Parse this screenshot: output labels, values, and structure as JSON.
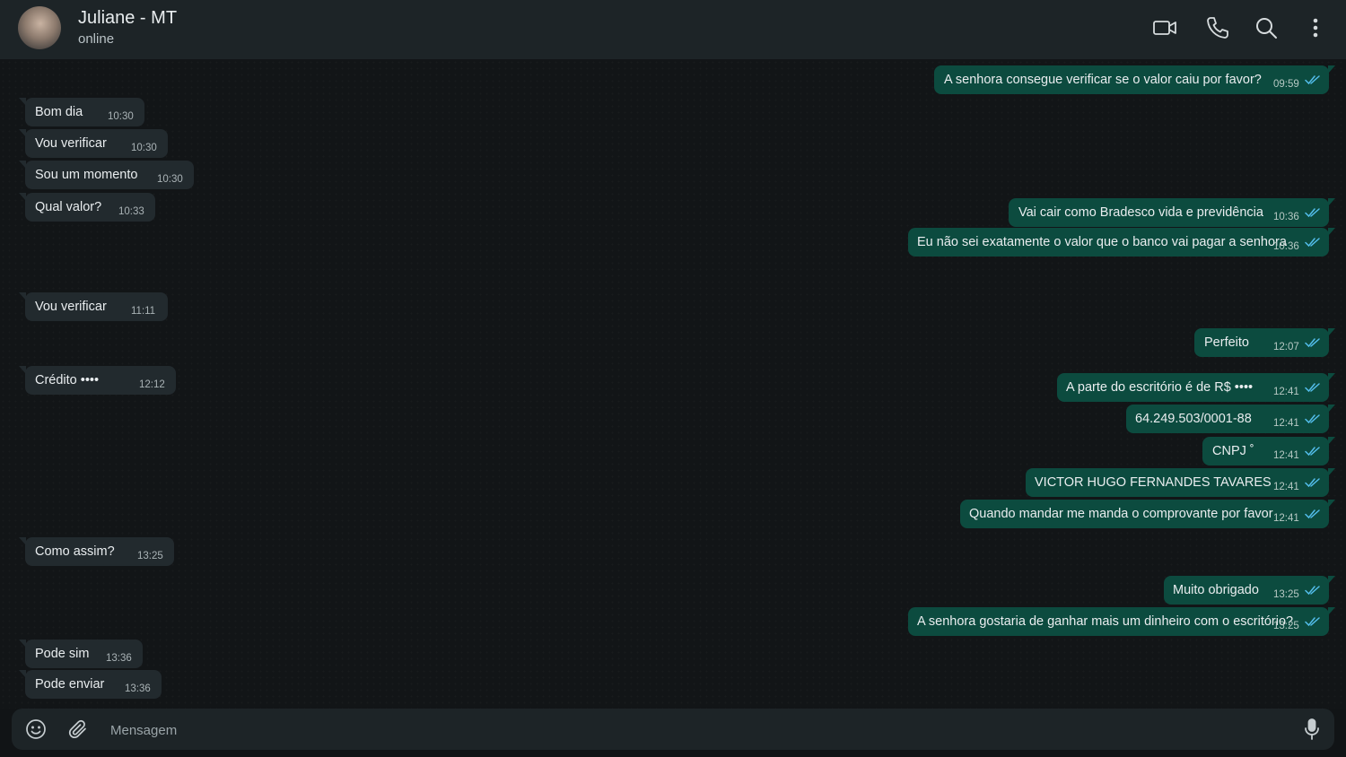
{
  "header": {
    "contact_name": "Juliane - MT",
    "status": "online",
    "icons": [
      "video-call-icon",
      "voice-call-icon",
      "search-icon",
      "menu-icon"
    ]
  },
  "messages": [
    {
      "dir": "out",
      "text": "A senhora consegue verificar se o valor caiu por favor?",
      "time": "09:59"
    },
    {
      "dir": "in",
      "text": "Bom dia",
      "time": "10:30"
    },
    {
      "dir": "in",
      "text": "Vou verificar",
      "time": "10:30"
    },
    {
      "dir": "in",
      "text": "Sou um momento",
      "time": "10:30"
    },
    {
      "dir": "in",
      "text": "Qual valor?",
      "time": "10:33"
    },
    {
      "dir": "out",
      "text": "Vai cair como Bradesco vida e previdência",
      "time": "10:36"
    },
    {
      "dir": "out",
      "text": "Eu não sei exatamente o valor que o banco vai pagar a senhora",
      "time": "10:36"
    },
    {
      "dir": "in",
      "text": "Vou verificar",
      "time": "11:11"
    },
    {
      "dir": "out",
      "text": "Perfeito",
      "time": "12:07"
    },
    {
      "dir": "in",
      "text": "Crédito ••••",
      "time": "12:12"
    },
    {
      "dir": "out",
      "text": "A parte do escritório é de R$ ••••",
      "time": "12:41"
    },
    {
      "dir": "out",
      "text": "64.249.503/0001-88",
      "time": "12:41"
    },
    {
      "dir": "out",
      "text": "CNPJ ˚",
      "time": "12:41"
    },
    {
      "dir": "out",
      "text": "VICTOR HUGO FERNANDES TAVARES",
      "time": "12:41"
    },
    {
      "dir": "out",
      "text": "Quando mandar me manda o comprovante por favor",
      "time": "12:41"
    },
    {
      "dir": "in",
      "text": "Como assim?",
      "time": "13:25"
    },
    {
      "dir": "out",
      "text": "Muito obrigado",
      "time": "13:25"
    },
    {
      "dir": "out",
      "text": "A senhora gostaria de ganhar mais um dinheiro com o escritório?",
      "time": "13:25"
    },
    {
      "dir": "in",
      "text": "Pode sim",
      "time": "13:36"
    },
    {
      "dir": "in",
      "text": "Pode enviar",
      "time": "13:36"
    }
  ],
  "composer": {
    "placeholder": "Mensagem",
    "icons": [
      "emoji-icon",
      "attach-icon",
      "mic-icon"
    ]
  },
  "colors": {
    "header_bg": "#1d2427",
    "chat_bg": "#121517",
    "incoming_bubble": "#222a2e",
    "outgoing_bubble": "#0c4b3f",
    "read_check": "#53bdeb"
  }
}
